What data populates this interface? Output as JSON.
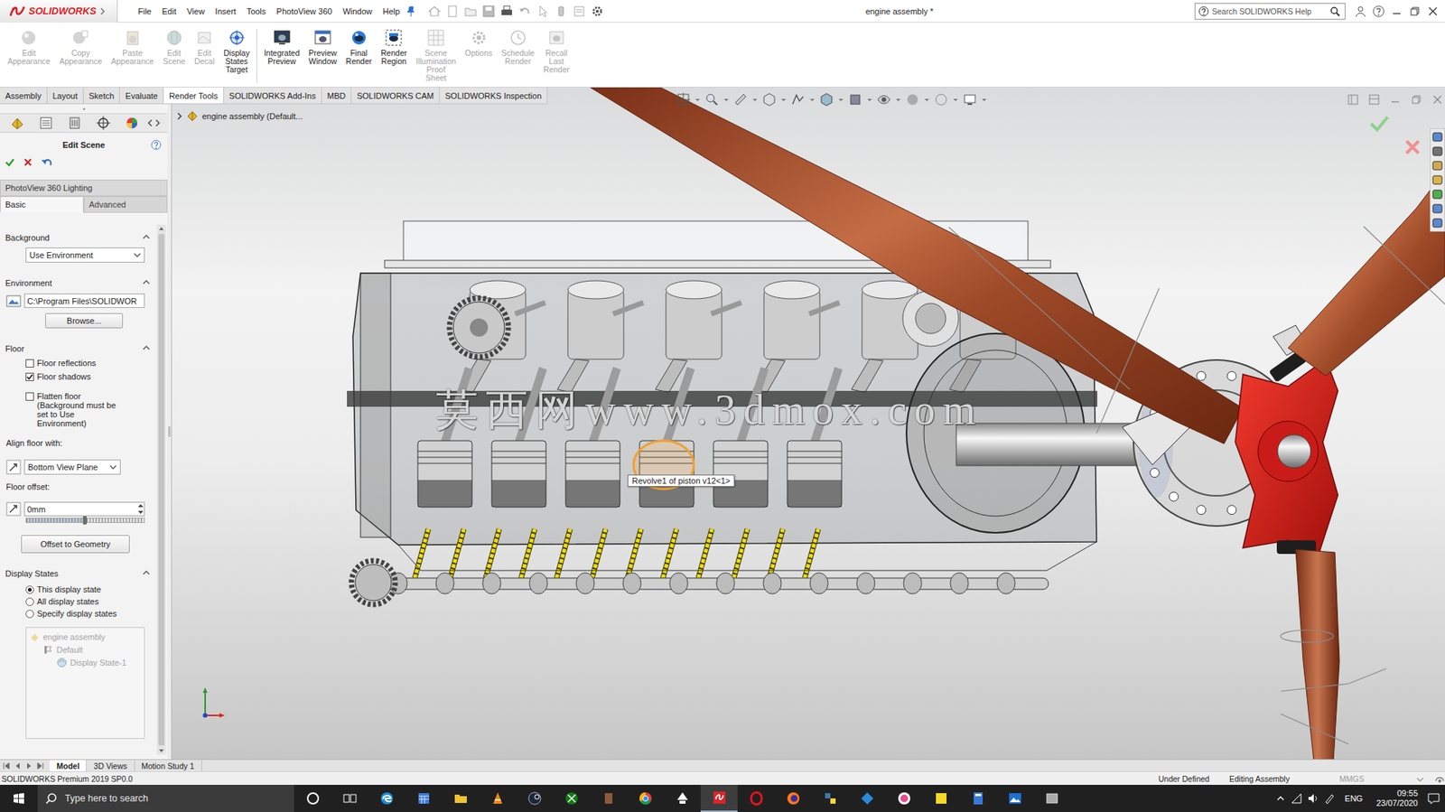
{
  "window": {
    "logo": "SOLIDWORKS",
    "title": "engine assembly *"
  },
  "menu": [
    "File",
    "Edit",
    "View",
    "Insert",
    "Tools",
    "PhotoView 360",
    "Window",
    "Help"
  ],
  "search": {
    "placeholder": "Search SOLIDWORKS Help"
  },
  "ribbon": [
    {
      "label": "Edit Appearance",
      "disabled": true
    },
    {
      "label": "Copy Appearance",
      "disabled": true
    },
    {
      "label": "Paste Appearance",
      "disabled": true
    },
    {
      "label": "Edit Scene",
      "disabled": true
    },
    {
      "label": "Edit Decal",
      "disabled": true
    },
    {
      "label": "Display States Target",
      "disabled": false
    },
    {
      "label": "Integrated Preview",
      "disabled": false
    },
    {
      "label": "Preview Window",
      "disabled": false
    },
    {
      "label": "Final Render",
      "disabled": false
    },
    {
      "label": "Render Region",
      "disabled": false
    },
    {
      "label": "Scene Illumination Proof Sheet",
      "disabled": true
    },
    {
      "label": "Options",
      "disabled": true
    },
    {
      "label": "Schedule Render",
      "disabled": true
    },
    {
      "label": "Recall Last Render",
      "disabled": true
    }
  ],
  "tabs": [
    {
      "label": "Assembly",
      "selected": false
    },
    {
      "label": "Layout",
      "selected": false
    },
    {
      "label": "Sketch",
      "selected": false
    },
    {
      "label": "Evaluate",
      "selected": false
    },
    {
      "label": "Render Tools",
      "selected": true
    },
    {
      "label": "SOLIDWORKS Add-Ins",
      "selected": false
    },
    {
      "label": "MBD",
      "selected": false
    },
    {
      "label": "SOLIDWORKS CAM",
      "selected": false
    },
    {
      "label": "SOLIDWORKS Inspection",
      "selected": false
    }
  ],
  "panel": {
    "title": "Edit Scene",
    "header": "PhotoView 360 Lighting",
    "subtabs": [
      {
        "label": "Basic",
        "selected": true
      },
      {
        "label": "Advanced",
        "selected": false
      }
    ],
    "background": {
      "title": "Background",
      "value": "Use Environment"
    },
    "environment": {
      "title": "Environment",
      "path": "C:\\Program Files\\SOLIDWOR",
      "button": "Browse..."
    },
    "floor": {
      "title": "Floor",
      "checks": [
        {
          "label": "Floor reflections",
          "checked": false
        },
        {
          "label": "Floor shadows",
          "checked": true
        },
        {
          "label": "Flatten floor (Background must be set to Use Environment)",
          "checked": false
        }
      ],
      "align_label": "Align floor with:",
      "align_value": "Bottom View Plane",
      "offset_label": "Floor offset:",
      "offset_value": "0mm",
      "offset_level": 0.5,
      "button": "Offset to Geometry"
    },
    "display_states": {
      "title": "Display States",
      "options": [
        {
          "label": "This display state",
          "selected": true
        },
        {
          "label": "All display states",
          "selected": false
        },
        {
          "label": "Specify display states",
          "selected": false
        }
      ],
      "tree": [
        {
          "label": "engine assembly",
          "disabled": true,
          "children": [
            {
              "label": "Default",
              "disabled": true,
              "children": [
                {
                  "label": "Display State-1",
                  "disabled": true,
                  "children": []
                }
              ]
            }
          ]
        }
      ]
    }
  },
  "viewport": {
    "breadcrumb": "engine assembly  (Default...",
    "tooltip": "Revolve1 of piston v12<1>",
    "watermark": "莫西网www.3dmox.com"
  },
  "bottom_tabs": [
    {
      "label": "Model",
      "selected": true
    },
    {
      "label": "3D Views",
      "selected": false
    },
    {
      "label": "Motion Study 1",
      "selected": false
    }
  ],
  "status_bar": {
    "product": "SOLIDWORKS Premium 2019 SP0.0",
    "items": [
      {
        "label": "Under Defined",
        "disabled": false
      },
      {
        "label": "Editing Assembly",
        "disabled": false
      },
      {
        "label": "MMGS",
        "disabled": true
      }
    ]
  },
  "taskbar": {
    "search": "Type here to search",
    "language": "ENG",
    "time": "09:55",
    "date": "23/07/2020"
  }
}
